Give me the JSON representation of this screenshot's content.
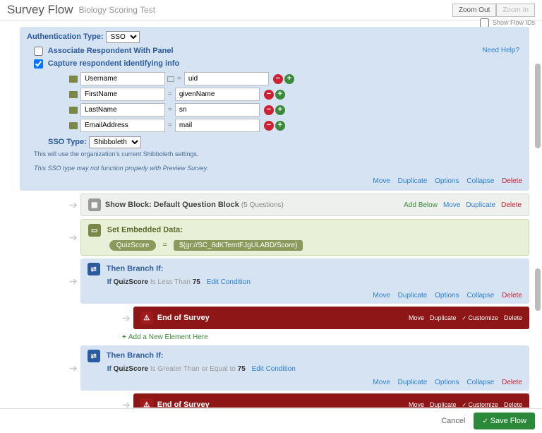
{
  "header": {
    "title": "Survey Flow",
    "subtitle": "Biology Scoring Test",
    "zoom_out": "Zoom Out",
    "zoom_in": "Zoom In",
    "show_flow_ids": "Show Flow IDs"
  },
  "auth": {
    "type_label": "Authentication Type:",
    "type_value": "SSO",
    "assoc": "Associate Respondent With Panel",
    "capture": "Capture respondent identifying info",
    "help": "Need Help?",
    "fields": [
      {
        "name": "Username",
        "map": "uid"
      },
      {
        "name": "FirstName",
        "map": "givenName"
      },
      {
        "name": "LastName",
        "map": "sn"
      },
      {
        "name": "EmailAddress",
        "map": "mail"
      }
    ],
    "sso_label": "SSO Type:",
    "sso_value": "Shibboleth",
    "note": "This will use the organization's current Shibboleth settings.",
    "warn": "This SSO type may not function properly with Preview Survey.",
    "actions": {
      "move": "Move",
      "dup": "Duplicate",
      "opt": "Options",
      "col": "Collapse",
      "del": "Delete"
    }
  },
  "show": {
    "label": "Show Block: Default Question Block",
    "count": "(5 Questions)",
    "add": "Add Below",
    "move": "Move",
    "dup": "Duplicate",
    "del": "Delete"
  },
  "embed": {
    "label": "Set Embedded Data:",
    "var": "QuizScore",
    "eq": "=",
    "val": "${gr://SC_8dKTemtFJgULABD/Score}"
  },
  "b1": {
    "label": "Then Branch If:",
    "if": "If",
    "var": "QuizScore",
    "op": "Is Less Than",
    "num": "75",
    "edit": "Edit Condition"
  },
  "b2": {
    "label": "Then Branch If:",
    "if": "If",
    "var": "QuizScore",
    "op": "Is Greater Than or Equal to",
    "num": "75",
    "edit": "Edit Condition"
  },
  "end": {
    "label": "End of Survey",
    "move": "Move",
    "dup": "Duplicate",
    "cust": "Customize",
    "del": "Delete"
  },
  "addnew": "Add a New Element Here",
  "footer": {
    "cancel": "Cancel",
    "save": "Save Flow"
  }
}
